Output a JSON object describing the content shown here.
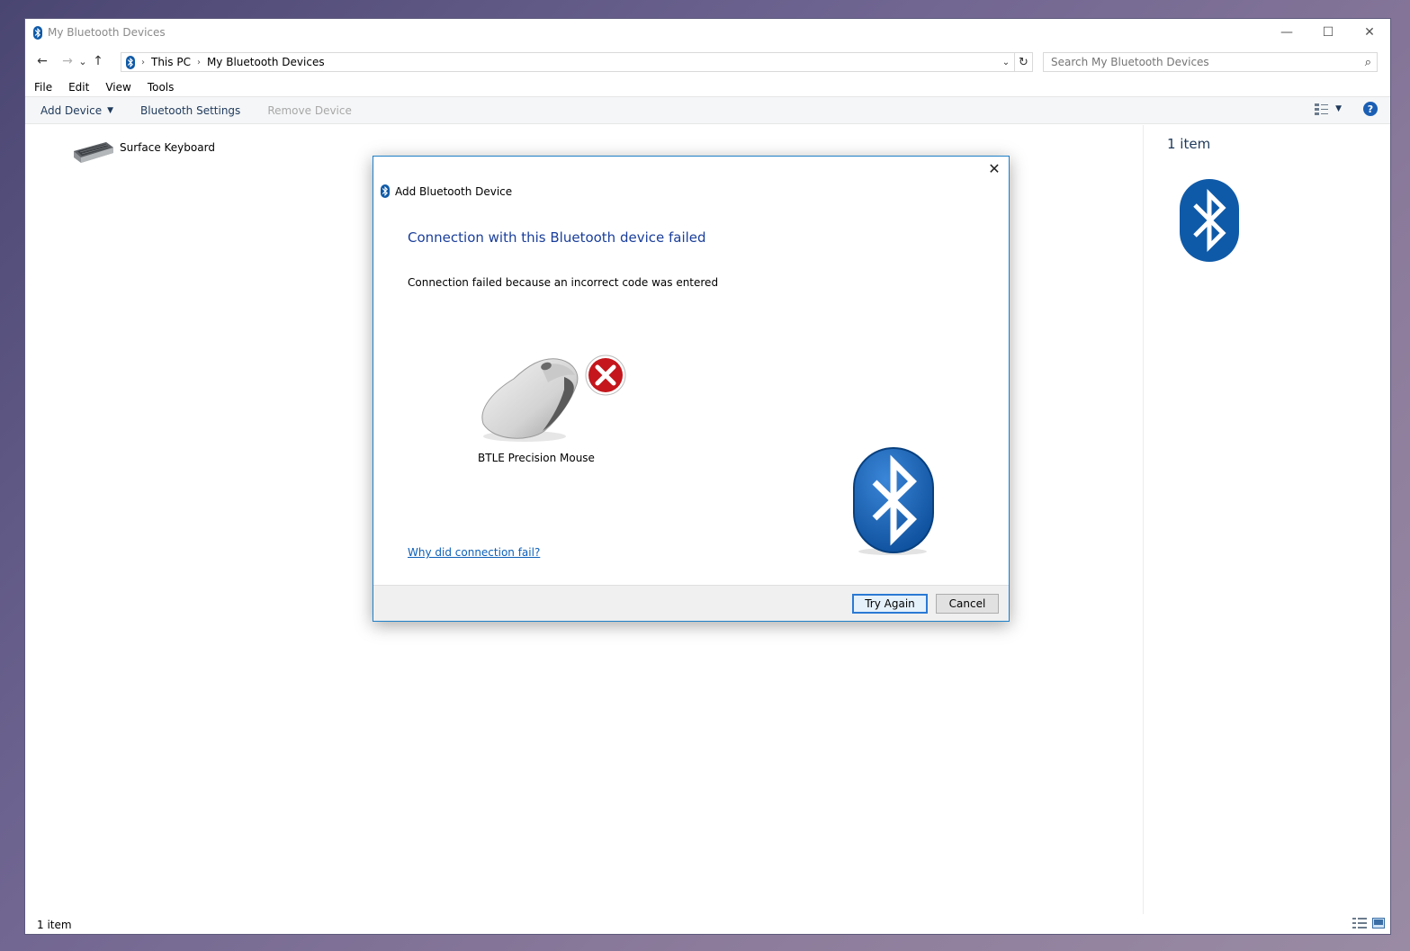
{
  "window": {
    "title": "My Bluetooth Devices",
    "controls": {
      "minimize": "—",
      "maximize": "☐",
      "close": "✕"
    }
  },
  "nav": {
    "back": "←",
    "forward": "→",
    "recent": "⌄",
    "up": "↑",
    "breadcrumb": [
      "This PC",
      "My Bluetooth Devices"
    ],
    "separator": "›",
    "refresh": "↻",
    "dropdown": "⌄"
  },
  "search": {
    "placeholder": "Search My Bluetooth Devices",
    "icon": "⌕"
  },
  "menu": [
    "File",
    "Edit",
    "View",
    "Tools"
  ],
  "commands": {
    "add_device": "Add Device",
    "bluetooth_settings": "Bluetooth Settings",
    "remove_device": "Remove Device",
    "help": "?"
  },
  "devices": [
    {
      "name": "Surface Keyboard"
    }
  ],
  "details": {
    "count": "1 item"
  },
  "status": {
    "text": "1 item"
  },
  "dialog": {
    "title": "Add Bluetooth Device",
    "heading": "Connection with this Bluetooth device failed",
    "message": "Connection failed because an incorrect code was entered",
    "device_name": "BTLE Precision Mouse",
    "help_link": "Why did connection fail?",
    "try_again": "Try Again",
    "cancel": "Cancel",
    "close": "✕"
  },
  "colors": {
    "bluetooth_blue": "#0f5aa8",
    "link": "#0d5fb8",
    "heading": "#1a3e9a",
    "command_text": "#1e395b",
    "error_red": "#c4161c"
  }
}
